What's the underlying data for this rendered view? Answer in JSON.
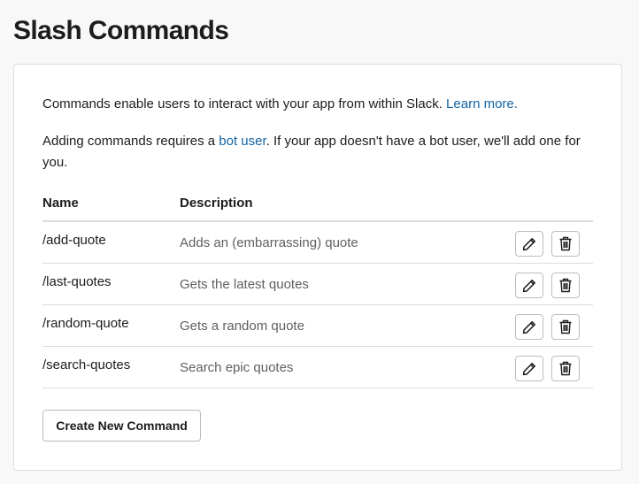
{
  "page": {
    "title": "Slash Commands"
  },
  "intro": {
    "text": "Commands enable users to interact with your app from within Slack.",
    "learn_more": "Learn more.",
    "bot_prefix": "Adding commands requires a ",
    "bot_link": "bot user",
    "bot_suffix": ". If your app doesn't have a bot user, we'll add one for you."
  },
  "table": {
    "headers": {
      "name": "Name",
      "description": "Description"
    },
    "rows": [
      {
        "name": "/add-quote",
        "description": "Adds an (embarrassing) quote"
      },
      {
        "name": "/last-quotes",
        "description": "Gets the latest quotes"
      },
      {
        "name": "/random-quote",
        "description": "Gets a random quote"
      },
      {
        "name": "/search-quotes",
        "description": "Search epic quotes"
      }
    ]
  },
  "actions": {
    "create_label": "Create New Command",
    "edit_icon": "pencil-icon",
    "delete_icon": "trash-icon"
  },
  "colors": {
    "link": "#1264a3",
    "muted_text": "#616061",
    "border": "#dddddd"
  }
}
